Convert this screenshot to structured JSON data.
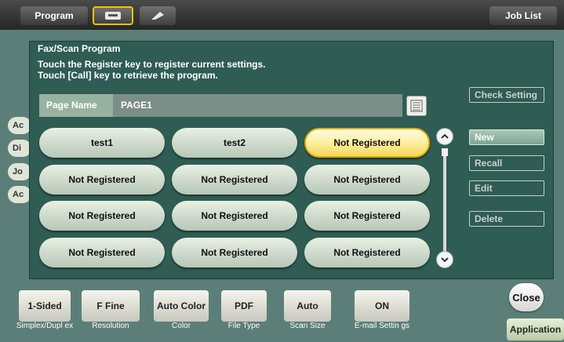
{
  "topbar": {
    "program_tab": "Program",
    "job_list": "Job List",
    "fax_icon": "fax-icon",
    "scan_icon": "scan-icon"
  },
  "background": {
    "side_tabs": [
      "Ac",
      "Di",
      "Jo",
      "Ac"
    ],
    "settings": [
      {
        "value": "1-Sided",
        "caption": "Simplex/Dupl ex"
      },
      {
        "value": "F Fine",
        "caption": "Resolution"
      },
      {
        "value": "Auto Color",
        "caption": "Color"
      },
      {
        "value": "PDF",
        "caption": "File Type"
      },
      {
        "value": "Auto",
        "caption": "Scan Size"
      },
      {
        "value": "ON",
        "caption": "E-mail Settin gs"
      }
    ],
    "application": "Application"
  },
  "dialog": {
    "title": "Fax/Scan Program",
    "message_line1": "Touch the Register key to register current settings.",
    "message_line2": "Touch [Call] key to retrieve the program.",
    "page_name_label": "Page Name",
    "page_name_value": "PAGE1",
    "programs": [
      "test1",
      "test2",
      "Not Registered",
      "Not Registered",
      "Not Registered",
      "Not Registered",
      "Not Registered",
      "Not Registered",
      "Not Registered",
      "Not Registered",
      "Not Registered",
      "Not Registered"
    ],
    "selected_index": 2,
    "actions": {
      "check_setting": "Check Setting",
      "new": "New",
      "recall": "Recall",
      "edit": "Edit",
      "delete": "Delete"
    },
    "close": "Close"
  },
  "colors": {
    "dialog_bg": "#2f5c53",
    "selected_border": "#e0b100",
    "accent_yellow": "#f1c400"
  }
}
